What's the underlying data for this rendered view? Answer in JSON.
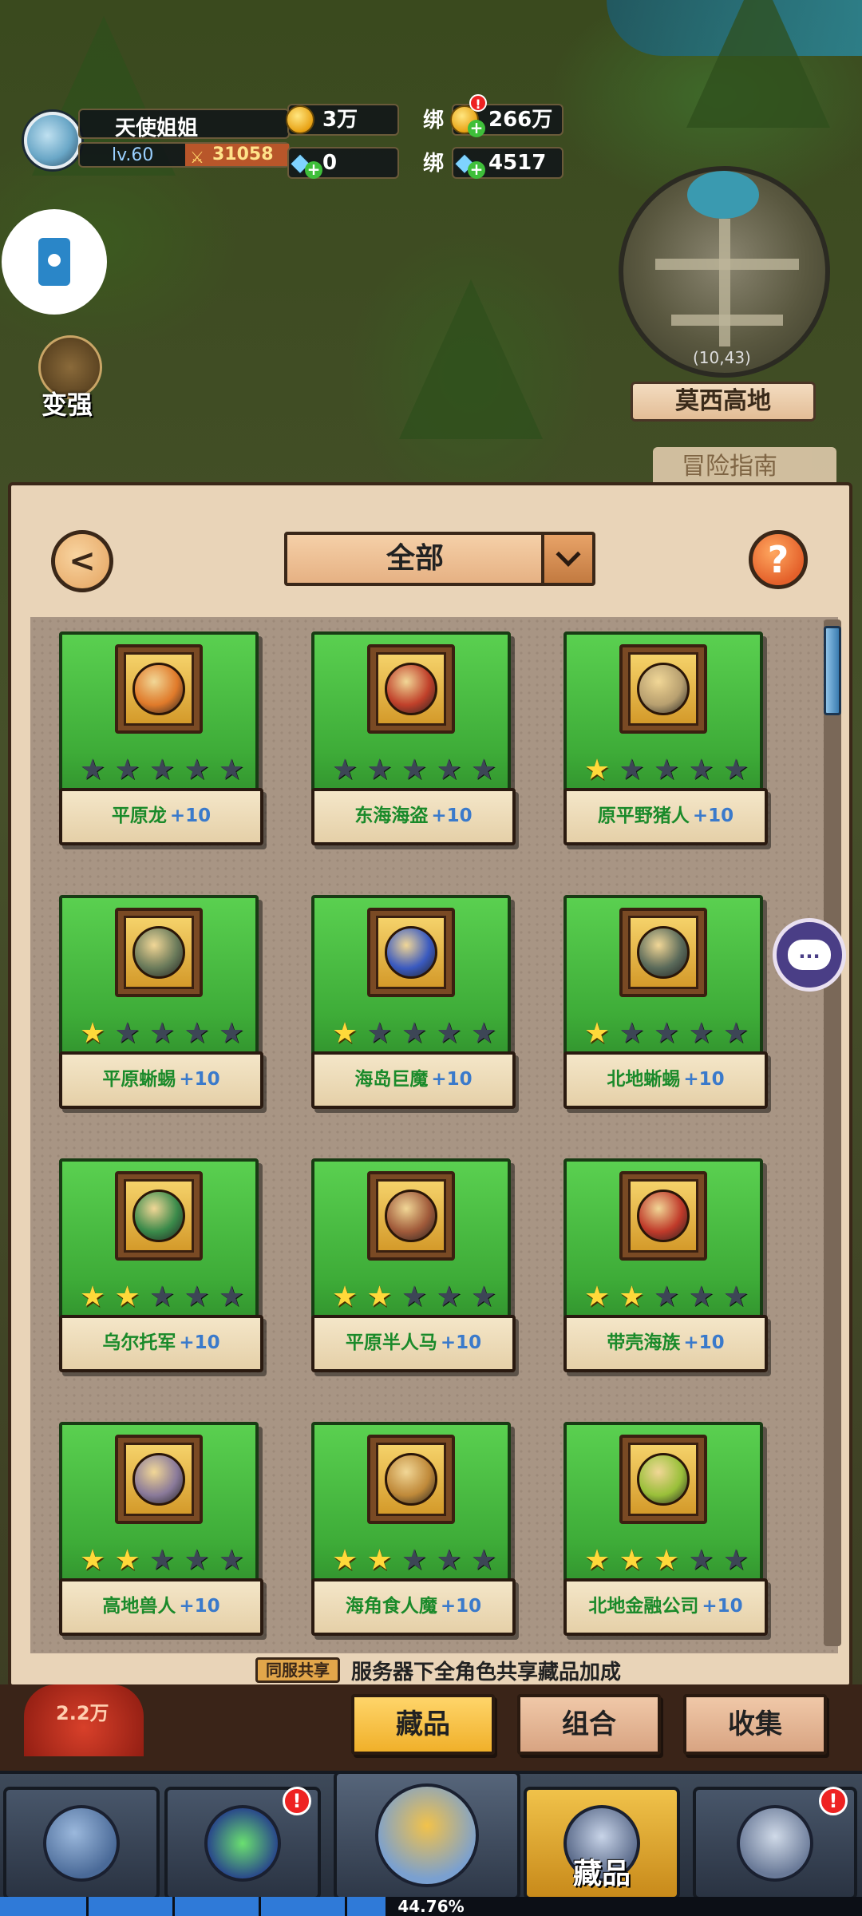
{
  "player": {
    "name": "天使姐姐",
    "level": "lv.60",
    "power": "31058"
  },
  "resources": {
    "gold": "3万",
    "diamond": "0",
    "bound_gold_prefix": "绑",
    "bound_gold": "266万",
    "bound_diamond_prefix": "绑",
    "bound_diamond": "4517",
    "alert": "!"
  },
  "side": {
    "strengthen_label": "变强"
  },
  "minimap": {
    "coords": "(10,43)",
    "location": "莫西高地",
    "guide": "冒险指南"
  },
  "panel": {
    "filter": "全部",
    "help": "?",
    "back": "<",
    "chat": "..."
  },
  "collection": [
    {
      "name": "平原龙",
      "level": "+10",
      "stars": 0,
      "face": "#e07a2a"
    },
    {
      "name": "东海海盗",
      "level": "+10",
      "stars": 0,
      "face": "#c0402a"
    },
    {
      "name": "原平野猪人",
      "level": "+10",
      "stars": 1,
      "face": "#b8a070"
    },
    {
      "name": "平原蜥蜴",
      "level": "+10",
      "stars": 1,
      "face": "#6a7a5a"
    },
    {
      "name": "海岛巨魔",
      "level": "+10",
      "stars": 1,
      "face": "#3a5ac0"
    },
    {
      "name": "北地蜥蜴",
      "level": "+10",
      "stars": 1,
      "face": "#5a6a5a"
    },
    {
      "name": "乌尔托军",
      "level": "+10",
      "stars": 2,
      "face": "#3a8a4a"
    },
    {
      "name": "平原半人马",
      "level": "+10",
      "stars": 2,
      "face": "#a05a3a"
    },
    {
      "name": "带壳海族",
      "level": "+10",
      "stars": 2,
      "face": "#c03a2a"
    },
    {
      "name": "高地兽人",
      "level": "+10",
      "stars": 2,
      "face": "#8a7a9a"
    },
    {
      "name": "海角食人魔",
      "level": "+10",
      "stars": 2,
      "face": "#c08a3a"
    },
    {
      "name": "北地金融公司",
      "level": "+10",
      "stars": 3,
      "face": "#9ac03a"
    }
  ],
  "share": {
    "tag": "同服共享",
    "text": "服务器下全角色共享藏品加成"
  },
  "boss": {
    "value": "2.2万"
  },
  "tabs": [
    {
      "label": "藏品",
      "active": true
    },
    {
      "label": "组合",
      "active": false
    },
    {
      "label": "收集",
      "active": false
    }
  ],
  "nav": {
    "collection_label": "藏品",
    "badge": "!"
  },
  "progress": {
    "text": "44.76%",
    "value": 0.4476
  },
  "colors": {
    "card_green": "#44b63c",
    "star_on": "#ffd93a",
    "star_off": "#3d4656",
    "name_green": "#1a8a2a",
    "level_blue": "#3a7acb",
    "panel": "#e9d4b8"
  }
}
